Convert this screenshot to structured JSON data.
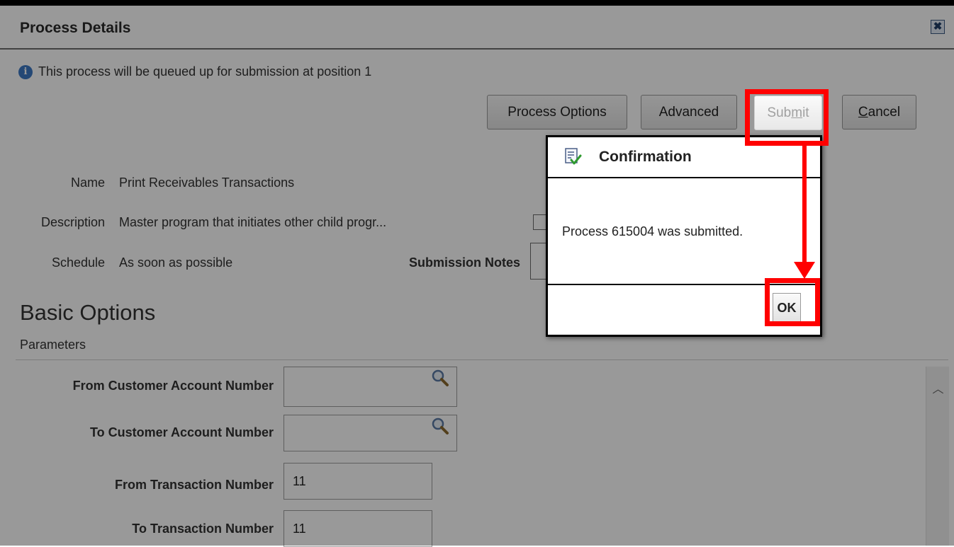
{
  "dialog_title": "Process Details",
  "close_symbol": "✖",
  "info_message": "This process will be queued up for submission at position 1",
  "buttons": {
    "process_options": "Process Options",
    "advanced": "Advanced",
    "submit": {
      "pre": "Sub",
      "mnemonic": "m",
      "post": "it"
    },
    "cancel": {
      "mnemonic": "C",
      "rest": "ancel"
    }
  },
  "details": {
    "name_label": "Name",
    "name_value": "Print Receivables Transactions",
    "description_label": "Description",
    "description_value": "Master program that initiates other child progr...",
    "schedule_label": "Schedule",
    "schedule_value": "As soon as possible",
    "submission_notes_label": "Submission Notes"
  },
  "section": {
    "basic_options": "Basic Options",
    "parameters": "Parameters"
  },
  "parameters": [
    {
      "label": "From Customer Account Number",
      "value": "",
      "lookup": true
    },
    {
      "label": "To Customer Account Number",
      "value": "",
      "lookup": true
    },
    {
      "label": "From Transaction Number",
      "value": "11",
      "lookup": false
    },
    {
      "label": "To Transaction Number",
      "value": "11",
      "lookup": false
    }
  ],
  "confirmation": {
    "title": "Confirmation",
    "message": "Process 615004 was submitted.",
    "ok_label": "OK"
  },
  "colors": {
    "annotation": "#ff0000",
    "info_icon": "#3d78c4"
  }
}
